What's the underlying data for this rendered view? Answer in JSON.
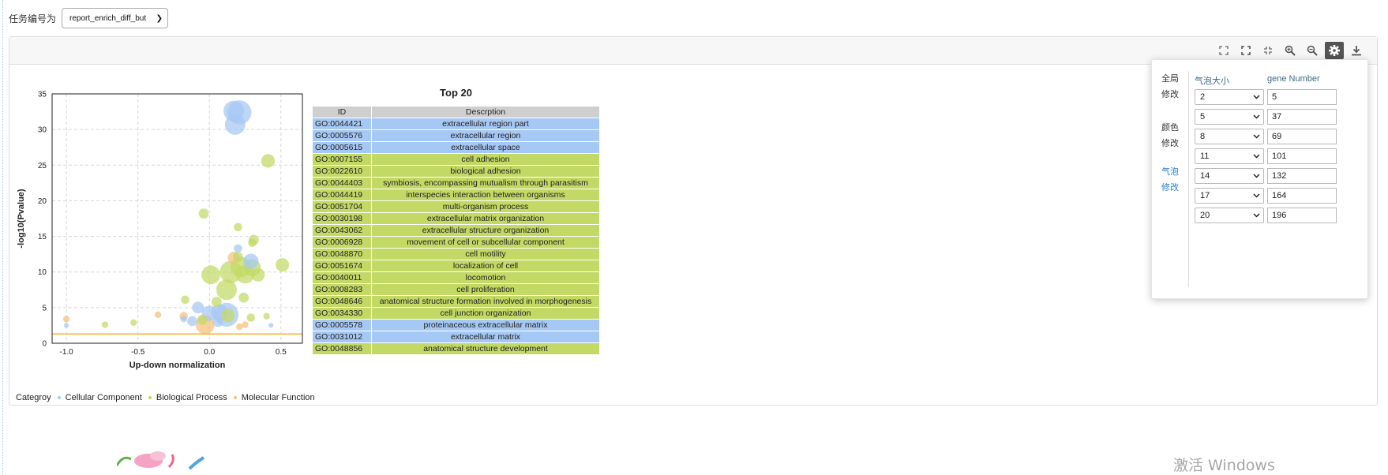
{
  "task": {
    "label": "任务编号为",
    "selected": "report_enrich_diff_but"
  },
  "toolbar": {
    "icons": [
      "expand-icon",
      "fullscreen-icon",
      "compress-icon",
      "zoom-in-icon",
      "zoom-out-icon",
      "settings-icon",
      "download-icon"
    ]
  },
  "chart_data": {
    "type": "scatter",
    "xlabel": "Up-down normalization",
    "ylabel": "-log10(Pvalue)",
    "xlim": [
      -1.1,
      0.65
    ],
    "ylim": [
      0,
      35
    ],
    "xticks": [
      "-1.0",
      "-0.5",
      "0.0",
      "0.5"
    ],
    "yticks": [
      "0",
      "5",
      "10",
      "15",
      "20",
      "25",
      "30",
      "35"
    ],
    "grid": true,
    "threshold_y": 1.3,
    "colors": {
      "Cellular Component": "#a6c8f4",
      "Biological Process": "#c2d965",
      "Molecular Function": "#f5bf7a",
      "threshold": "#f5b43c"
    },
    "points": [
      {
        "x": 0.17,
        "y": 32.6,
        "size": 10,
        "cat": "Cellular Component"
      },
      {
        "x": 0.21,
        "y": 32.4,
        "size": 12,
        "cat": "Cellular Component"
      },
      {
        "x": 0.18,
        "y": 30.7,
        "size": 10,
        "cat": "Cellular Component"
      },
      {
        "x": 0.41,
        "y": 25.6,
        "size": 6,
        "cat": "Biological Process"
      },
      {
        "x": -0.04,
        "y": 18.2,
        "size": 4,
        "cat": "Biological Process"
      },
      {
        "x": 0.2,
        "y": 16.3,
        "size": 3,
        "cat": "Biological Process"
      },
      {
        "x": 0.31,
        "y": 14.5,
        "size": 4,
        "cat": "Biological Process"
      },
      {
        "x": 0.3,
        "y": 14.1,
        "size": 3,
        "cat": "Biological Process"
      },
      {
        "x": 0.2,
        "y": 13.3,
        "size": 3,
        "cat": "Cellular Component"
      },
      {
        "x": 0.2,
        "y": 12.1,
        "size": 4,
        "cat": "Biological Process"
      },
      {
        "x": 0.17,
        "y": 12.0,
        "size": 5,
        "cat": "Molecular Function"
      },
      {
        "x": 0.29,
        "y": 11.5,
        "size": 7,
        "cat": "Cellular Component"
      },
      {
        "x": 0.51,
        "y": 11.0,
        "size": 6,
        "cat": "Biological Process"
      },
      {
        "x": 0.22,
        "y": 10.7,
        "size": 10,
        "cat": "Biological Process"
      },
      {
        "x": 0.3,
        "y": 10.6,
        "size": 8,
        "cat": "Biological Process"
      },
      {
        "x": 0.15,
        "y": 10.0,
        "size": 11,
        "cat": "Biological Process"
      },
      {
        "x": 0.34,
        "y": 9.6,
        "size": 6,
        "cat": "Biological Process"
      },
      {
        "x": 0.25,
        "y": 9.7,
        "size": 9,
        "cat": "Biological Process"
      },
      {
        "x": 0.01,
        "y": 9.6,
        "size": 9,
        "cat": "Biological Process"
      },
      {
        "x": 0.12,
        "y": 7.5,
        "size": 10,
        "cat": "Biological Process"
      },
      {
        "x": 0.24,
        "y": 6.4,
        "size": 4,
        "cat": "Biological Process"
      },
      {
        "x": 0.05,
        "y": 5.8,
        "size": 4,
        "cat": "Biological Process"
      },
      {
        "x": -0.08,
        "y": 5.0,
        "size": 5,
        "cat": "Cellular Component"
      },
      {
        "x": -0.17,
        "y": 6.1,
        "size": 3,
        "cat": "Biological Process"
      },
      {
        "x": 0.0,
        "y": 4.2,
        "size": 7,
        "cat": "Cellular Component"
      },
      {
        "x": 0.07,
        "y": 4.3,
        "size": 8,
        "cat": "Cellular Component"
      },
      {
        "x": 0.12,
        "y": 4.0,
        "size": 12,
        "cat": "Cellular Component"
      },
      {
        "x": 0.13,
        "y": 3.9,
        "size": 6,
        "cat": "Biological Process"
      },
      {
        "x": 0.29,
        "y": 3.6,
        "size": 3,
        "cat": "Biological Process"
      },
      {
        "x": 0.4,
        "y": 3.8,
        "size": 2,
        "cat": "Biological Process"
      },
      {
        "x": -0.18,
        "y": 3.8,
        "size": 3,
        "cat": "Molecular Function"
      },
      {
        "x": -0.05,
        "y": 3.3,
        "size": 4,
        "cat": "Biological Process"
      },
      {
        "x": -0.12,
        "y": 3.1,
        "size": 4,
        "cat": "Cellular Component"
      },
      {
        "x": -0.18,
        "y": 3.4,
        "size": 2,
        "cat": "Cellular Component"
      },
      {
        "x": -0.03,
        "y": 2.6,
        "size": 9,
        "cat": "Molecular Function"
      },
      {
        "x": 0.06,
        "y": 3.0,
        "size": 4,
        "cat": "Cellular Component"
      },
      {
        "x": -0.36,
        "y": 4.0,
        "size": 2,
        "cat": "Molecular Function"
      },
      {
        "x": -0.53,
        "y": 2.9,
        "size": 2,
        "cat": "Biological Process"
      },
      {
        "x": -0.73,
        "y": 2.6,
        "size": 2,
        "cat": "Biological Process"
      },
      {
        "x": -1.0,
        "y": 3.4,
        "size": 2,
        "cat": "Molecular Function"
      },
      {
        "x": -1.0,
        "y": 2.5,
        "size": 1,
        "cat": "Cellular Component"
      },
      {
        "x": 0.43,
        "y": 2.5,
        "size": 1,
        "cat": "Cellular Component"
      },
      {
        "x": 0.25,
        "y": 2.6,
        "size": 2,
        "cat": "Molecular Function"
      },
      {
        "x": 0.21,
        "y": 2.3,
        "size": 2,
        "cat": "Molecular Function"
      }
    ]
  },
  "table": {
    "title": "Top 20",
    "headers": [
      "ID",
      "Descrption"
    ],
    "colors": {
      "Cellular Component": "#a6c8f4",
      "Biological Process": "#c2d965"
    },
    "rows": [
      {
        "id": "GO:0044421",
        "desc": "extracellular region part",
        "cat": "Cellular Component"
      },
      {
        "id": "GO:0005576",
        "desc": "extracellular region",
        "cat": "Cellular Component"
      },
      {
        "id": "GO:0005615",
        "desc": "extracellular space",
        "cat": "Cellular Component"
      },
      {
        "id": "GO:0007155",
        "desc": "cell adhesion",
        "cat": "Biological Process"
      },
      {
        "id": "GO:0022610",
        "desc": "biological adhesion",
        "cat": "Biological Process"
      },
      {
        "id": "GO:0044403",
        "desc": "symbiosis, encompassing mutualism through parasitism",
        "cat": "Biological Process"
      },
      {
        "id": "GO:0044419",
        "desc": "interspecies interaction between organisms",
        "cat": "Biological Process"
      },
      {
        "id": "GO:0051704",
        "desc": "multi-organism process",
        "cat": "Biological Process"
      },
      {
        "id": "GO:0030198",
        "desc": "extracellular matrix organization",
        "cat": "Biological Process"
      },
      {
        "id": "GO:0043062",
        "desc": "extracellular structure organization",
        "cat": "Biological Process"
      },
      {
        "id": "GO:0006928",
        "desc": "movement of cell or subcellular component",
        "cat": "Biological Process"
      },
      {
        "id": "GO:0048870",
        "desc": "cell motility",
        "cat": "Biological Process"
      },
      {
        "id": "GO:0051674",
        "desc": "localization of cell",
        "cat": "Biological Process"
      },
      {
        "id": "GO:0040011",
        "desc": "locomotion",
        "cat": "Biological Process"
      },
      {
        "id": "GO:0008283",
        "desc": "cell proliferation",
        "cat": "Biological Process"
      },
      {
        "id": "GO:0048646",
        "desc": "anatomical structure formation involved in morphogenesis",
        "cat": "Biological Process"
      },
      {
        "id": "GO:0034330",
        "desc": "cell junction organization",
        "cat": "Biological Process"
      },
      {
        "id": "GO:0005578",
        "desc": "proteinaceous extracellular matrix",
        "cat": "Cellular Component"
      },
      {
        "id": "GO:0031012",
        "desc": "extracellular matrix",
        "cat": "Cellular Component"
      },
      {
        "id": "GO:0048856",
        "desc": "anatomical structure development",
        "cat": "Biological Process"
      }
    ]
  },
  "legend": {
    "title": "Categroy",
    "items": [
      {
        "label": "Cellular Component",
        "color": "#a6c8f4"
      },
      {
        "label": "Biological Process",
        "color": "#c2d965"
      },
      {
        "label": "Molecular Function",
        "color": "#f5bf7a"
      }
    ]
  },
  "popup": {
    "side": {
      "global": [
        "全局",
        "修改"
      ],
      "color": [
        "颜色",
        "修改"
      ],
      "bubble": [
        "气泡",
        "修改"
      ]
    },
    "header_bubble": "气泡大小",
    "header_gene": "gene Number",
    "rows": [
      {
        "size": "2",
        "gene": "5"
      },
      {
        "size": "5",
        "gene": "37"
      },
      {
        "size": "8",
        "gene": "69"
      },
      {
        "size": "11",
        "gene": "101"
      },
      {
        "size": "14",
        "gene": "132"
      },
      {
        "size": "17",
        "gene": "164"
      },
      {
        "size": "20",
        "gene": "196"
      }
    ]
  },
  "watermark": "激活 Windows"
}
